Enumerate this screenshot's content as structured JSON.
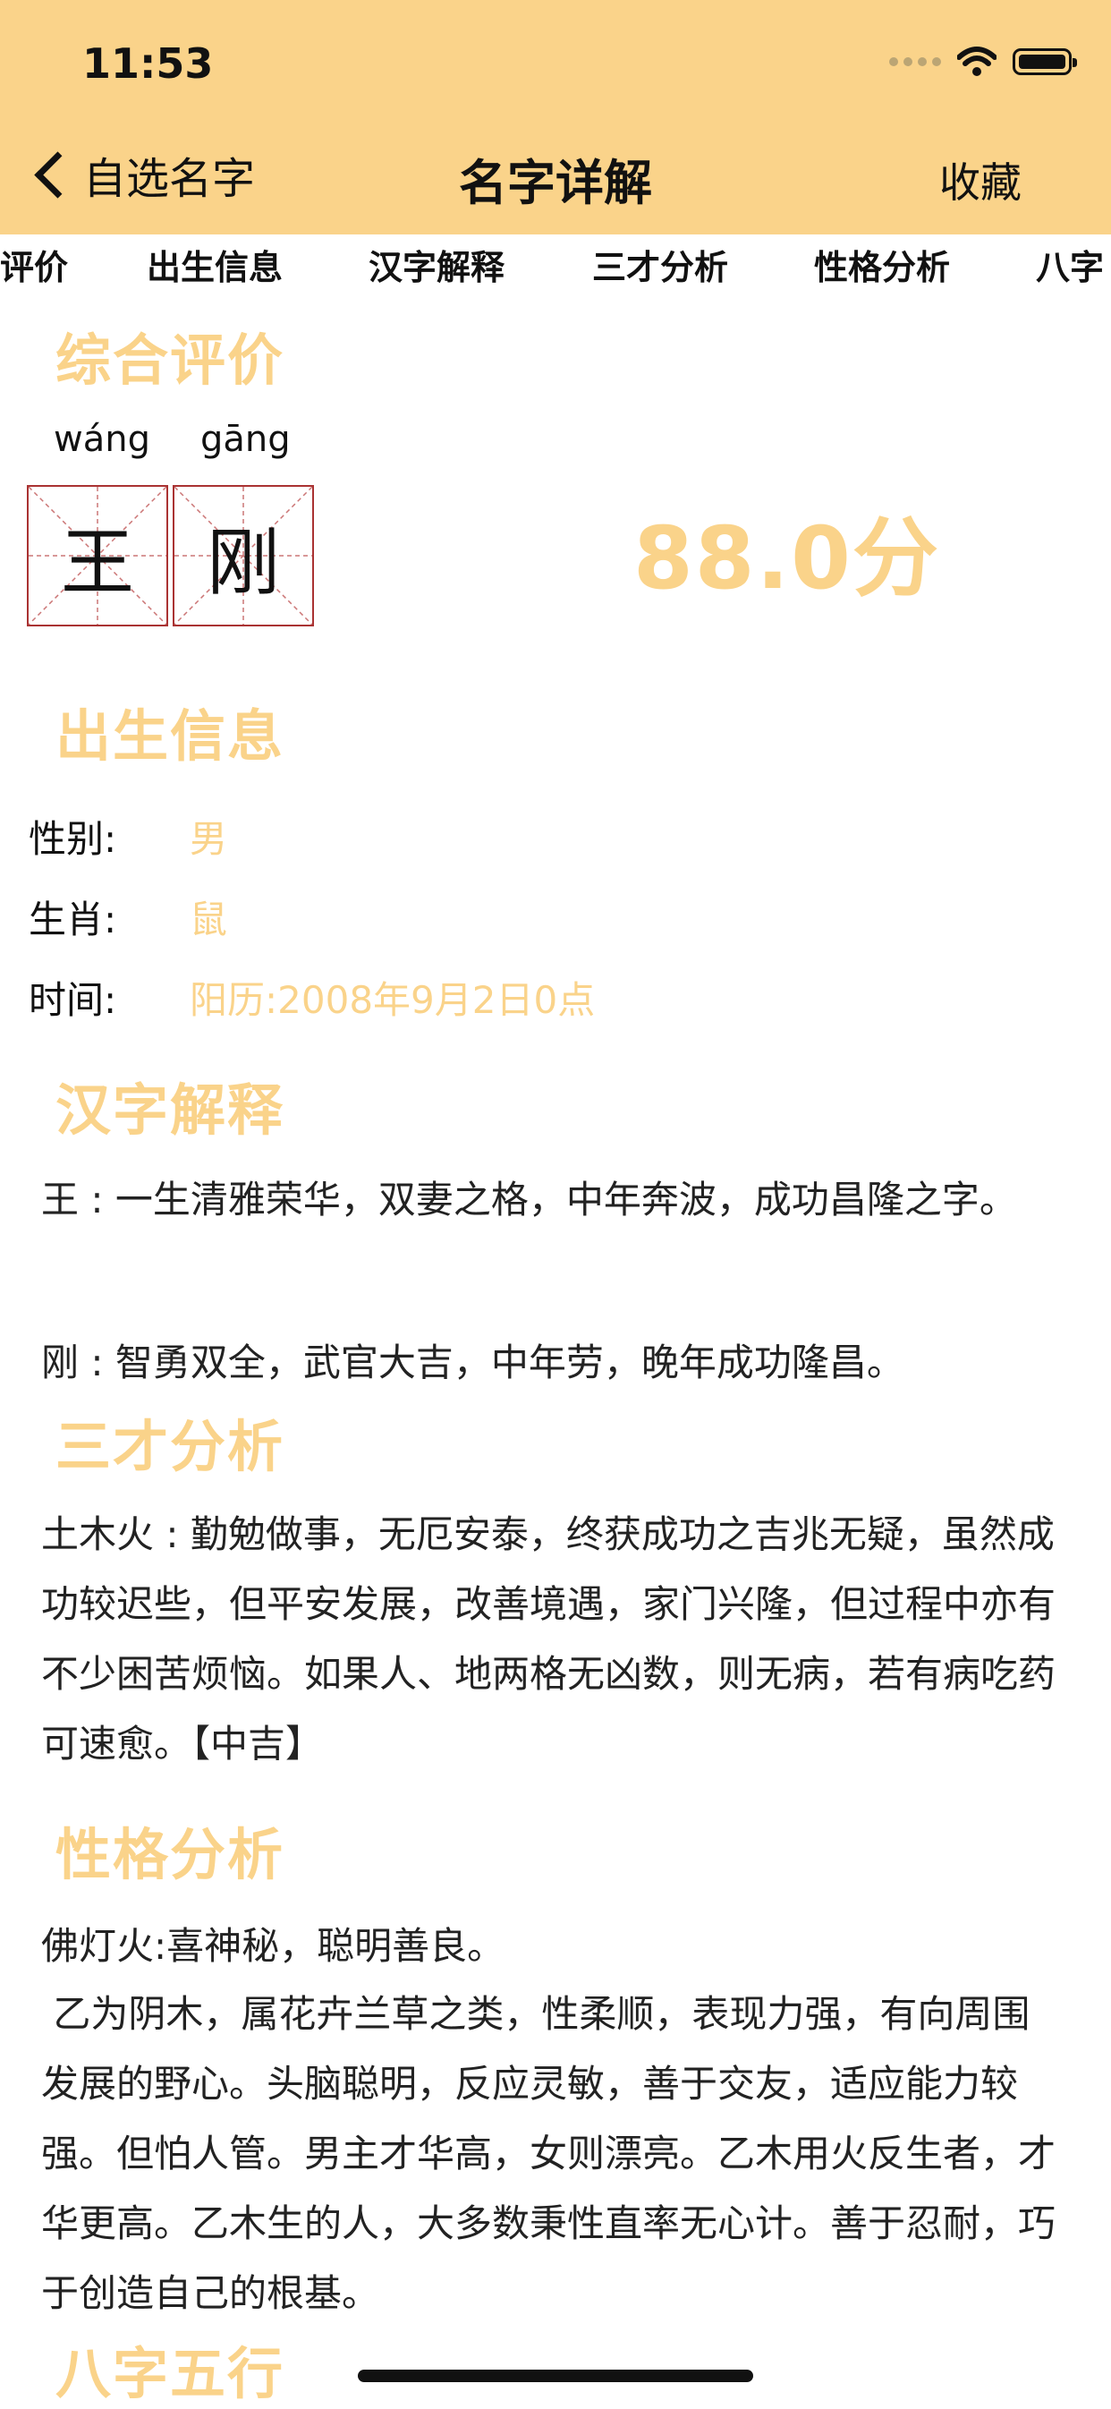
{
  "status_bar": {
    "time": "11:53"
  },
  "nav": {
    "back_label": "自选名字",
    "title": "名字详解",
    "favorite_label": "收藏"
  },
  "tabs": [
    "评价",
    "出生信息",
    "汉字解释",
    "三才分析",
    "性格分析",
    "八字"
  ],
  "overall": {
    "title": "综合评价",
    "chars": [
      {
        "pinyin": "wáng",
        "char": "王"
      },
      {
        "pinyin": "gāng",
        "char": "刚"
      }
    ],
    "score": "88.0分"
  },
  "birth": {
    "title": "出生信息",
    "rows": [
      {
        "label": "性别:",
        "value": "男"
      },
      {
        "label": "生肖:",
        "value": "鼠"
      },
      {
        "label": "时间:",
        "value": "阳历:2008年9月2日0点"
      }
    ]
  },
  "hanzi": {
    "title": "汉字解释",
    "items": [
      "王 : 一生清雅荣华，双妻之格，中年奔波，成功昌隆之字。",
      "刚 : 智勇双全，武官大吉，中年劳，晚年成功隆昌。"
    ]
  },
  "sancai": {
    "title": "三才分析",
    "text": "土木火 : 勤勉做事，无厄安泰，终获成功之吉兆无疑，虽然成功较迟些，但平安发展，改善境遇，家门兴隆，但过程中亦有不少困苦烦恼。如果人、地两格无凶数，则无病，若有病吃药可速愈。【中吉】"
  },
  "personality": {
    "title": "性格分析",
    "line1": "佛灯火:喜神秘，聪明善良。",
    "text": " 乙为阴木，属花卉兰草之类，性柔顺，表现力强，有向周围发展的野心。头脑聪明，反应灵敏，善于交友，适应能力较强。但怕人管。男主才华高，女则漂亮。乙木用火反生者，才华更高。乙木生的人，大多数秉性直率无心计。善于忍耐，巧于创造自己的根基。"
  },
  "bazi": {
    "title": "八字五行"
  },
  "colors": {
    "accent": "#FAD38A",
    "text": "#222222"
  }
}
